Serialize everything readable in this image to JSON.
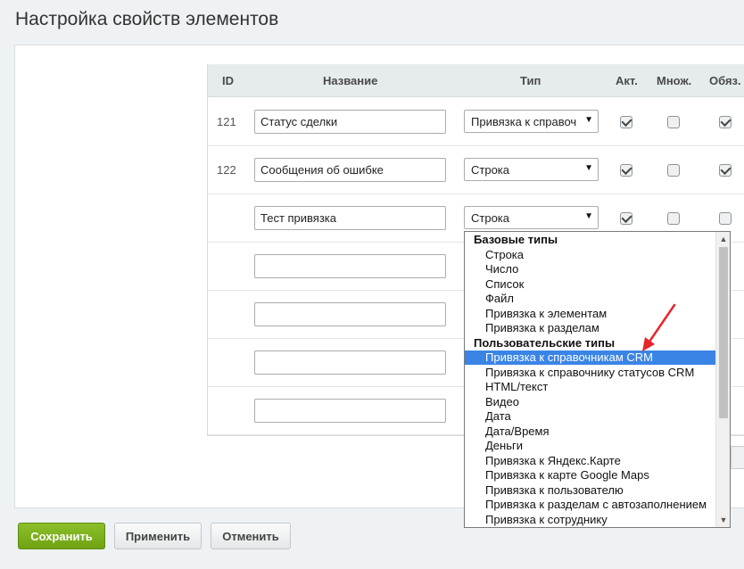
{
  "page": {
    "title": "Настройка свойств элементов"
  },
  "table": {
    "headers": {
      "id": "ID",
      "name": "Название",
      "type": "Тип",
      "active": "Акт.",
      "multiple": "Множ.",
      "required": "Обяз."
    },
    "rows": [
      {
        "id": "121",
        "name": "Статус сделки",
        "type": "Привязка к справоч",
        "active": true,
        "multiple": false,
        "required": true
      },
      {
        "id": "122",
        "name": "Сообщения об ошибке",
        "type": "Строка",
        "active": true,
        "multiple": false,
        "required": true
      },
      {
        "id": "",
        "name": "Тест привязка",
        "type": "Строка",
        "active": true,
        "multiple": false,
        "required": false
      },
      {
        "id": "",
        "name": "",
        "type": "",
        "active": false,
        "multiple": false,
        "required": false
      },
      {
        "id": "",
        "name": "",
        "type": "",
        "active": false,
        "multiple": false,
        "required": false
      },
      {
        "id": "",
        "name": "",
        "type": "",
        "active": false,
        "multiple": false,
        "required": false
      },
      {
        "id": "",
        "name": "",
        "type": "",
        "active": false,
        "multiple": false,
        "required": false
      }
    ]
  },
  "dropdown": {
    "items": [
      {
        "label": "Базовые типы",
        "group": true
      },
      {
        "label": "Строка"
      },
      {
        "label": "Число"
      },
      {
        "label": "Список"
      },
      {
        "label": "Файл"
      },
      {
        "label": "Привязка к элементам"
      },
      {
        "label": "Привязка к разделам"
      },
      {
        "label": "Пользовательские типы",
        "group": true
      },
      {
        "label": "Привязка к справочникам CRM",
        "highlighted": true
      },
      {
        "label": "Привязка к справочнику статусов CRM"
      },
      {
        "label": "HTML/текст"
      },
      {
        "label": "Видео"
      },
      {
        "label": "Дата"
      },
      {
        "label": "Дата/Время"
      },
      {
        "label": "Деньги"
      },
      {
        "label": "Привязка к Яндекс.Карте"
      },
      {
        "label": "Привязка к карте Google Maps"
      },
      {
        "label": "Привязка к пользователю"
      },
      {
        "label": "Привязка к разделам с автозаполнением"
      },
      {
        "label": "Привязка к сотруднику"
      }
    ]
  },
  "buttons": {
    "save": "Сохранить",
    "apply": "Применить",
    "cancel": "Отменить"
  },
  "colors": {
    "accent_green": "#7cb31d",
    "highlight_blue": "#3a84e6",
    "annotation_red": "#e8242b"
  },
  "icons": {
    "select_arrow": "▼",
    "scroll_up": "▲",
    "scroll_down": "▼"
  }
}
